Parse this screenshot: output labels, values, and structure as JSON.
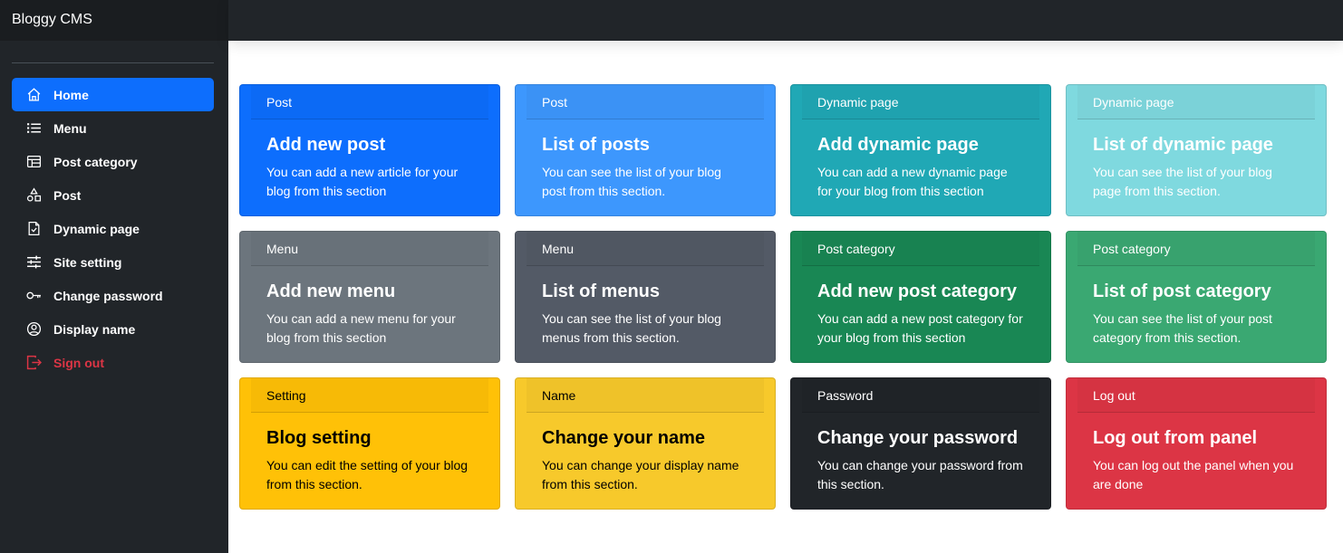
{
  "brand": "Bloggy CMS",
  "sidebar": {
    "items": [
      {
        "label": "Home",
        "icon": "home-icon",
        "active": true
      },
      {
        "label": "Menu",
        "icon": "list-icon"
      },
      {
        "label": "Post category",
        "icon": "table-icon"
      },
      {
        "label": "Post",
        "icon": "shapes-icon"
      },
      {
        "label": "Dynamic page",
        "icon": "file-check-icon"
      },
      {
        "label": "Site setting",
        "icon": "sliders-icon"
      },
      {
        "label": "Change password",
        "icon": "key-icon"
      },
      {
        "label": "Display name",
        "icon": "user-circle-icon"
      },
      {
        "label": "Sign out",
        "icon": "sign-out-icon",
        "danger": true
      }
    ]
  },
  "cards": [
    {
      "header": "Post",
      "title": "Add new post",
      "text": "You can add a new article for your blog from this section",
      "color": "#0d6efd"
    },
    {
      "header": "Post",
      "title": "List of posts",
      "text": "You can see the list of your blog post from this section.",
      "color": "#3d97fd"
    },
    {
      "header": "Dynamic page",
      "title": "Add dynamic page",
      "text": "You can add a new dynamic page for your blog from this section",
      "color": "#20a8b5"
    },
    {
      "header": "Dynamic page",
      "title": "List of dynamic page",
      "text": "You can see the list of your blog page from this section.",
      "color": "#7fd9df"
    },
    {
      "header": "Menu",
      "title": "Add new menu",
      "text": "You can add a new menu for your blog from this section",
      "color": "#6c757d"
    },
    {
      "header": "Menu",
      "title": "List of menus",
      "text": "You can see the list of your blog menus from this section.",
      "color": "#535a66"
    },
    {
      "header": "Post category",
      "title": "Add new post category",
      "text": "You can add a new post category for your blog from this section",
      "color": "#198754"
    },
    {
      "header": "Post category",
      "title": "List of post category",
      "text": "You can see the list of your post category from this section.",
      "color": "#3aa872"
    },
    {
      "header": "Setting",
      "title": "Blog setting",
      "text": "You can edit the setting of your blog from this section.",
      "color": "#ffc107"
    },
    {
      "header": "Name",
      "title": "Change your name",
      "text": "You can change your display name from this section.",
      "color": "#f7c92b"
    },
    {
      "header": "Password",
      "title": "Change your password",
      "text": "You can change your password from this section.",
      "color": "#212529"
    },
    {
      "header": "Log out",
      "title": "Log out from panel",
      "text": "You can log out the panel when you are done",
      "color": "#dc3545"
    }
  ]
}
